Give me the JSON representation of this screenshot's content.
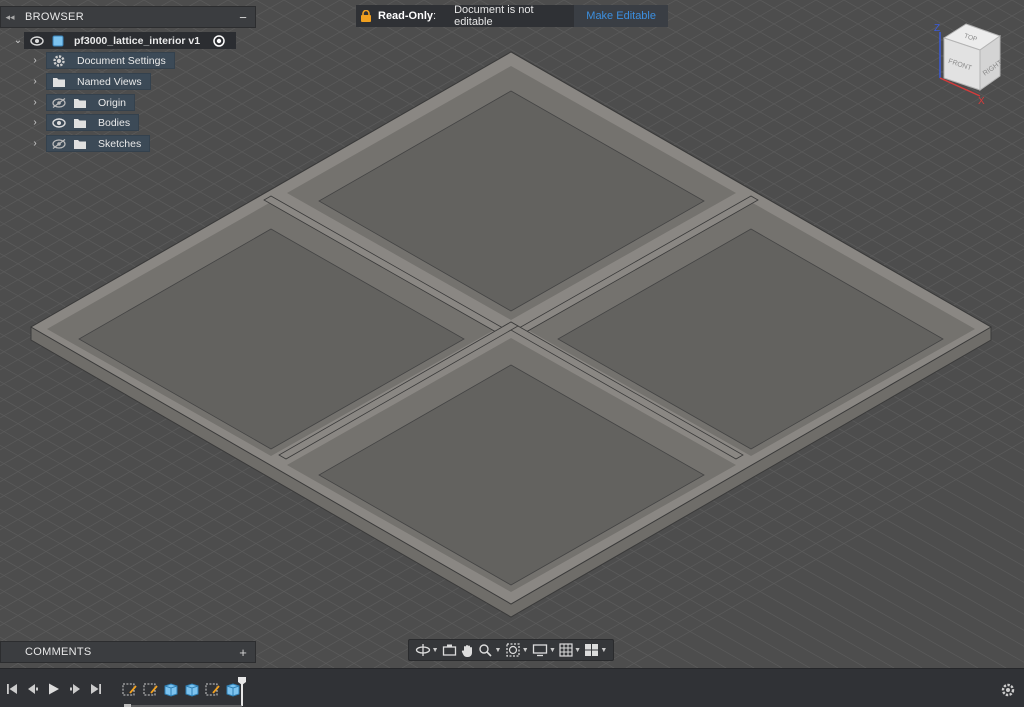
{
  "browser": {
    "title": "BROWSER",
    "collapse_icon": "double-chevron-left-icon",
    "minimize_icon": "minus-icon",
    "root": {
      "label": "pf3000_lattice_interior v1",
      "visibility": "eye-icon",
      "active": "radio-active-icon"
    },
    "items": [
      {
        "label": "Document Settings",
        "icon": "gear-icon",
        "visibility": "none"
      },
      {
        "label": "Named Views",
        "icon": "folder-icon",
        "visibility": "none"
      },
      {
        "label": "Origin",
        "icon": "folder-icon",
        "visibility": "eye-hidden-icon"
      },
      {
        "label": "Bodies",
        "icon": "folder-icon",
        "visibility": "eye-icon"
      },
      {
        "label": "Sketches",
        "icon": "folder-icon",
        "visibility": "eye-hidden-icon"
      }
    ]
  },
  "readonly_bar": {
    "icon": "lock-icon",
    "label": "Read-Only",
    "separator": ":",
    "message": "Document is not editable",
    "action": "Make Editable",
    "action_color": "#3c8fdf"
  },
  "viewcube": {
    "faces": [
      "TOP",
      "FRONT",
      "RIGHT"
    ],
    "axis_z": "Z",
    "axis_x": "X",
    "axis_z_color": "#3b5bdb",
    "axis_x_color": "#d63b3b"
  },
  "comments": {
    "title": "COMMENTS",
    "add_icon": "plus-icon"
  },
  "nav_toolbar": {
    "tools": [
      "orbit-icon",
      "look-at-icon",
      "pan-icon",
      "zoom-icon",
      "fit-icon",
      "display-settings-icon",
      "grid-icon",
      "viewports-icon"
    ]
  },
  "timeline": {
    "controls": [
      "skip-to-start-icon",
      "step-back-icon",
      "play-icon",
      "step-forward-icon",
      "skip-to-end-icon"
    ],
    "features": [
      "sketch-icon",
      "sketch-icon",
      "extrude-icon",
      "extrude-icon",
      "sketch-icon",
      "extrude-icon"
    ],
    "settings_icon": "timeline-settings-icon"
  },
  "colors": {
    "viewport_bg": "#4d4d4d",
    "grid_line": "#585858",
    "model_fill": "#7c7a76",
    "model_top": "#8b8884",
    "panel_bg": "#3b3d40",
    "node_bg": "#3c4a57"
  }
}
